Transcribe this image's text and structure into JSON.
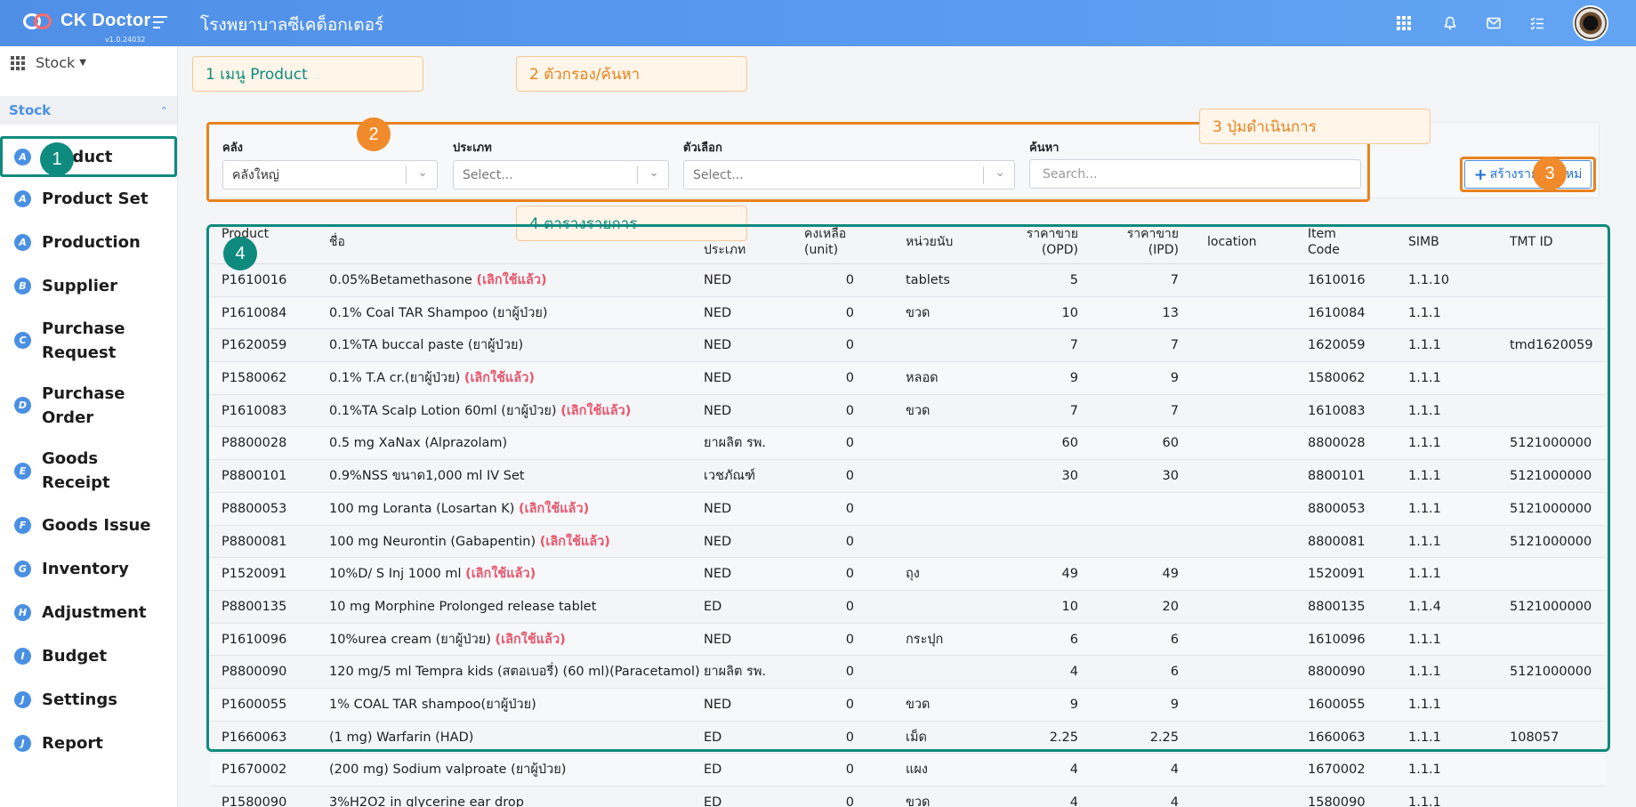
{
  "app": {
    "name": "CK Doctor",
    "version": "v1.0.24032",
    "hospital": "โรงพยาบาลซีเคด็อกเตอร์"
  },
  "header_icons": [
    "apps-grid-icon",
    "bell-icon",
    "mail-icon",
    "checklist-icon",
    "avatar"
  ],
  "sidebar": {
    "module_select": "Stock",
    "section": "Stock",
    "items": [
      {
        "badge": "A",
        "label": "Product"
      },
      {
        "badge": "A",
        "label": "Product Set"
      },
      {
        "badge": "A",
        "label": "Production"
      },
      {
        "badge": "B",
        "label": "Supplier"
      },
      {
        "badge": "C",
        "label": "Purchase Request"
      },
      {
        "badge": "D",
        "label": "Purchase Order"
      },
      {
        "badge": "E",
        "label": "Goods Receipt"
      },
      {
        "badge": "F",
        "label": "Goods Issue"
      },
      {
        "badge": "G",
        "label": "Inventory"
      },
      {
        "badge": "H",
        "label": "Adjustment"
      },
      {
        "badge": "I",
        "label": "Budget"
      },
      {
        "badge": "J",
        "label": "Settings"
      },
      {
        "badge": "J",
        "label": "Report"
      }
    ]
  },
  "callouts": {
    "c1": "1 เมนู Product",
    "c2": "2 ตัวกรอง/ค้นหา",
    "c3": "3 ปุ่มดำเนินการ",
    "c4": "4 ตารางรายการ",
    "n1": "1",
    "n2": "2",
    "n3": "3",
    "n4": "4"
  },
  "filters": {
    "warehouse_label": "คลัง",
    "warehouse_value": "คลังใหญ่",
    "type_label": "ประเภท",
    "type_placeholder": "Select...",
    "option_label": "ตัวเลือก",
    "option_placeholder": "Select...",
    "search_label": "ค้นหา",
    "search_placeholder": "Search..."
  },
  "actions": {
    "create_label": "สร้างรายการใหม่"
  },
  "table": {
    "headers": {
      "product": "Product",
      "name": "ชื่อ",
      "type": "ประเภท",
      "remain": "คงเหลือ (unit)",
      "unit": "หน่วยนับ",
      "price_opd": "ราคาขาย (OPD)",
      "price_ipd": "ราคาขาย (IPD)",
      "location": "location",
      "item_code": "Item Code",
      "simb": "SIMB",
      "tmt": "TMT ID"
    },
    "rows": [
      {
        "product": "P1610016",
        "name": "0.05%Betamethasone",
        "tag": "(เลิกใช้แล้ว)",
        "type": "NED",
        "remain": "0",
        "unit": "tablets",
        "opd": "5",
        "ipd": "7",
        "location": "",
        "code": "1610016",
        "simb": "1.1.10",
        "tmt": ""
      },
      {
        "product": "P1610084",
        "name": "0.1% Coal TAR Shampoo (ยาผู้ป่วย)",
        "tag": "",
        "type": "NED",
        "remain": "0",
        "unit": "ขวด",
        "opd": "10",
        "ipd": "13",
        "location": "",
        "code": "1610084",
        "simb": "1.1.1",
        "tmt": ""
      },
      {
        "product": "P1620059",
        "name": "0.1%TA buccal paste (ยาผู้ป่วย)",
        "tag": "",
        "type": "NED",
        "remain": "0",
        "unit": "",
        "opd": "7",
        "ipd": "7",
        "location": "",
        "code": "1620059",
        "simb": "1.1.1",
        "tmt": "tmd1620059"
      },
      {
        "product": "P1580062",
        "name": "0.1% T.A cr.(ยาผู้ป่วย)",
        "tag": "(เลิกใช้แล้ว)",
        "type": "NED",
        "remain": "0",
        "unit": "หลอด",
        "opd": "9",
        "ipd": "9",
        "location": "",
        "code": "1580062",
        "simb": "1.1.1",
        "tmt": ""
      },
      {
        "product": "P1610083",
        "name": "0.1%TA Scalp Lotion 60ml (ยาผู้ป่วย)",
        "tag": "(เลิกใช้แล้ว)",
        "type": "NED",
        "remain": "0",
        "unit": "ขวด",
        "opd": "7",
        "ipd": "7",
        "location": "",
        "code": "1610083",
        "simb": "1.1.1",
        "tmt": ""
      },
      {
        "product": "P8800028",
        "name": "0.5 mg XaNax (Alprazolam)",
        "tag": "",
        "type": "ยาผลิต รพ.",
        "remain": "0",
        "unit": "",
        "opd": "60",
        "ipd": "60",
        "location": "",
        "code": "8800028",
        "simb": "1.1.1",
        "tmt": "5121000000"
      },
      {
        "product": "P8800101",
        "name": "0.9%NSS ขนาด1,000 ml IV Set",
        "tag": "",
        "type": "เวชภัณฑ์",
        "remain": "0",
        "unit": "",
        "opd": "30",
        "ipd": "30",
        "location": "",
        "code": "8800101",
        "simb": "1.1.1",
        "tmt": "5121000000"
      },
      {
        "product": "P8800053",
        "name": "100 mg Loranta (Losartan K)",
        "tag": "(เลิกใช้แล้ว)",
        "type": "NED",
        "remain": "0",
        "unit": "",
        "opd": "",
        "ipd": "",
        "location": "",
        "code": "8800053",
        "simb": "1.1.1",
        "tmt": "5121000000"
      },
      {
        "product": "P8800081",
        "name": "100 mg Neurontin (Gabapentin)",
        "tag": "(เลิกใช้แล้ว)",
        "type": "NED",
        "remain": "0",
        "unit": "",
        "opd": "",
        "ipd": "",
        "location": "",
        "code": "8800081",
        "simb": "1.1.1",
        "tmt": "5121000000"
      },
      {
        "product": "P1520091",
        "name": "10%D/ S Inj 1000 ml",
        "tag": "(เลิกใช้แล้ว)",
        "type": "NED",
        "remain": "0",
        "unit": "ถุง",
        "opd": "49",
        "ipd": "49",
        "location": "",
        "code": "1520091",
        "simb": "1.1.1",
        "tmt": ""
      },
      {
        "product": "P8800135",
        "name": "10 mg Morphine Prolonged release tablet",
        "tag": "",
        "type": "ED",
        "remain": "0",
        "unit": "",
        "opd": "10",
        "ipd": "20",
        "location": "",
        "code": "8800135",
        "simb": "1.1.4",
        "tmt": "5121000000"
      },
      {
        "product": "P1610096",
        "name": "10%urea cream (ยาผู้ป่วย)",
        "tag": "(เลิกใช้แล้ว)",
        "type": "NED",
        "remain": "0",
        "unit": "กระปุก",
        "opd": "6",
        "ipd": "6",
        "location": "",
        "code": "1610096",
        "simb": "1.1.1",
        "tmt": ""
      },
      {
        "product": "P8800090",
        "name": "120 mg/5 ml Tempra kids (สตอเบอรี่) (60 ml)(Paracetamol)",
        "tag": "",
        "type": "ยาผลิต รพ.",
        "remain": "0",
        "unit": "",
        "opd": "4",
        "ipd": "6",
        "location": "",
        "code": "8800090",
        "simb": "1.1.1",
        "tmt": "5121000000"
      },
      {
        "product": "P1600055",
        "name": "1% COAL TAR shampoo(ยาผู้ป่วย)",
        "tag": "",
        "type": "NED",
        "remain": "0",
        "unit": "ขวด",
        "opd": "9",
        "ipd": "9",
        "location": "",
        "code": "1600055",
        "simb": "1.1.1",
        "tmt": ""
      },
      {
        "product": "P1660063",
        "name": "(1 mg) Warfarin (HAD)",
        "tag": "",
        "type": "ED",
        "remain": "0",
        "unit": "เม็ด",
        "opd": "2.25",
        "ipd": "2.25",
        "location": "",
        "code": "1660063",
        "simb": "1.1.1",
        "tmt": "108057"
      },
      {
        "product": "P1670002",
        "name": "(200 mg) Sodium valproate (ยาผู้ป่วย)",
        "tag": "",
        "type": "ED",
        "remain": "0",
        "unit": "แผง",
        "opd": "4",
        "ipd": "4",
        "location": "",
        "code": "1670002",
        "simb": "1.1.1",
        "tmt": ""
      },
      {
        "product": "P1580090",
        "name": "3%H2O2 in glycerine ear drop",
        "tag": "",
        "type": "ED",
        "remain": "0",
        "unit": "ขวด",
        "opd": "4",
        "ipd": "4",
        "location": "",
        "code": "1580090",
        "simb": "1.1.1",
        "tmt": ""
      }
    ]
  },
  "colors": {
    "header": "#5b9bf0",
    "accent": "#4a90e2",
    "annotation_orange": "#e8821e",
    "annotation_teal": "#0f8a7e",
    "deprecated_tag": "#e8566c"
  }
}
